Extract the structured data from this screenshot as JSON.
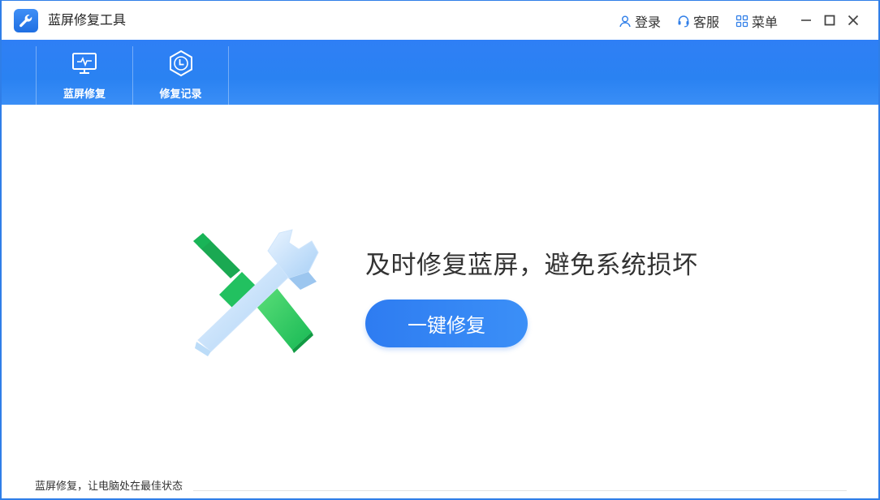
{
  "window": {
    "title": "蓝屏修复工具",
    "accent_color": "#2f7ee8"
  },
  "titlebar": {
    "actions": [
      {
        "label": "登录",
        "icon": "user-icon"
      },
      {
        "label": "客服",
        "icon": "headset-icon"
      },
      {
        "label": "菜单",
        "icon": "grid-menu-icon"
      }
    ],
    "controls": [
      "minimize-icon",
      "maximize-icon",
      "close-icon"
    ]
  },
  "nav": {
    "items": [
      {
        "label": "蓝屏修复",
        "icon": "monitor-pulse-icon"
      },
      {
        "label": "修复记录",
        "icon": "clock-hexagon-icon"
      }
    ]
  },
  "hero": {
    "slogan": "及时修复蓝屏，避免系统损坏",
    "button_label": "一键修复",
    "graphic": "wrench-screwdriver-icon"
  },
  "footer": {
    "status_text": "蓝屏修复，让电脑处在最佳状态"
  }
}
